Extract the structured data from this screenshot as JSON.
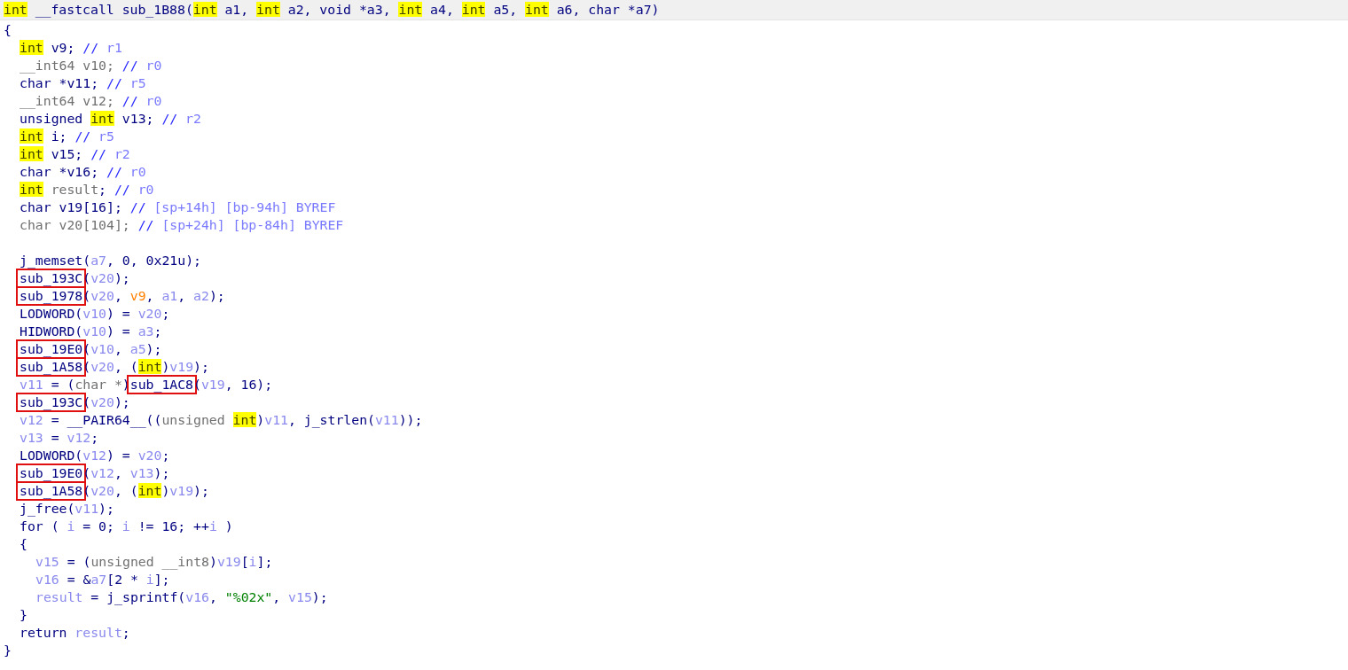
{
  "signature": [
    {
      "text": "int",
      "kind": "hl"
    },
    {
      "text": " __fastcall sub_1B88(",
      "kind": "p"
    },
    {
      "text": "int",
      "kind": "hl"
    },
    {
      "text": " a1, ",
      "kind": "p"
    },
    {
      "text": "int",
      "kind": "hl"
    },
    {
      "text": " a2, void *a3, ",
      "kind": "p"
    },
    {
      "text": "int",
      "kind": "hl"
    },
    {
      "text": " a4, ",
      "kind": "p"
    },
    {
      "text": "int",
      "kind": "hl"
    },
    {
      "text": " a5, ",
      "kind": "p"
    },
    {
      "text": "int",
      "kind": "hl"
    },
    {
      "text": " a6, char *a7)",
      "kind": "p"
    }
  ],
  "lines": [
    {
      "kind": "top",
      "tokens": [
        {
          "text": "{",
          "kind": "p"
        }
      ]
    },
    {
      "kind": "body",
      "tokens": [
        {
          "text": "int",
          "kind": "hl"
        },
        {
          "text": " v9; ",
          "kind": "p"
        },
        {
          "text": "// ",
          "kind": "c"
        },
        {
          "text": "r1",
          "kind": "cm"
        }
      ]
    },
    {
      "kind": "body",
      "tokens": [
        {
          "text": "__int64 v10; ",
          "kind": "g"
        },
        {
          "text": "// ",
          "kind": "c"
        },
        {
          "text": "r0",
          "kind": "cm"
        }
      ]
    },
    {
      "kind": "body",
      "tokens": [
        {
          "text": "char *v11; ",
          "kind": "p"
        },
        {
          "text": "// ",
          "kind": "c"
        },
        {
          "text": "r5",
          "kind": "cm"
        }
      ]
    },
    {
      "kind": "body",
      "tokens": [
        {
          "text": "__int64 v12; ",
          "kind": "g"
        },
        {
          "text": "// ",
          "kind": "c"
        },
        {
          "text": "r0",
          "kind": "cm"
        }
      ]
    },
    {
      "kind": "body",
      "tokens": [
        {
          "text": "unsigned ",
          "kind": "p"
        },
        {
          "text": "int",
          "kind": "hl"
        },
        {
          "text": " v13; ",
          "kind": "p"
        },
        {
          "text": "// ",
          "kind": "c"
        },
        {
          "text": "r2",
          "kind": "cm"
        }
      ]
    },
    {
      "kind": "body",
      "tokens": [
        {
          "text": "int",
          "kind": "hl"
        },
        {
          "text": " i; ",
          "kind": "p"
        },
        {
          "text": "// ",
          "kind": "c"
        },
        {
          "text": "r5",
          "kind": "cm"
        }
      ]
    },
    {
      "kind": "body",
      "tokens": [
        {
          "text": "int",
          "kind": "hl"
        },
        {
          "text": " v15; ",
          "kind": "p"
        },
        {
          "text": "// ",
          "kind": "c"
        },
        {
          "text": "r2",
          "kind": "cm"
        }
      ]
    },
    {
      "kind": "body",
      "tokens": [
        {
          "text": "char *v16; ",
          "kind": "p"
        },
        {
          "text": "// ",
          "kind": "c"
        },
        {
          "text": "r0",
          "kind": "cm"
        }
      ]
    },
    {
      "kind": "body",
      "tokens": [
        {
          "text": "int",
          "kind": "hl"
        },
        {
          "text": " result",
          "kind": "g"
        },
        {
          "text": "; ",
          "kind": "p"
        },
        {
          "text": "// ",
          "kind": "c"
        },
        {
          "text": "r0",
          "kind": "cm"
        }
      ]
    },
    {
      "kind": "body",
      "tokens": [
        {
          "text": "char v19[16]; ",
          "kind": "p"
        },
        {
          "text": "// ",
          "kind": "c"
        },
        {
          "text": "[sp+14h] [bp-94h] BYREF",
          "kind": "cm"
        }
      ]
    },
    {
      "kind": "body",
      "tokens": [
        {
          "text": "char v20[104]; ",
          "kind": "g"
        },
        {
          "text": "// ",
          "kind": "c"
        },
        {
          "text": "[sp+24h] [bp-84h] BYREF",
          "kind": "cm"
        }
      ]
    },
    {
      "kind": "blank"
    },
    {
      "kind": "body",
      "tokens": [
        {
          "text": "j_memset(",
          "kind": "p"
        },
        {
          "text": "a7",
          "kind": "v"
        },
        {
          "text": ", ",
          "kind": "p"
        },
        {
          "text": "0",
          "kind": "n"
        },
        {
          "text": ", ",
          "kind": "p"
        },
        {
          "text": "0x21u",
          "kind": "n"
        },
        {
          "text": ");",
          "kind": "p"
        }
      ]
    },
    {
      "kind": "body",
      "tokens": [
        {
          "text": "sub_193C",
          "kind": "box"
        },
        {
          "text": "(",
          "kind": "p"
        },
        {
          "text": "v20",
          "kind": "v"
        },
        {
          "text": ");",
          "kind": "p"
        }
      ]
    },
    {
      "kind": "body",
      "tokens": [
        {
          "text": "sub_1978",
          "kind": "box"
        },
        {
          "text": "(",
          "kind": "p"
        },
        {
          "text": "v20",
          "kind": "v"
        },
        {
          "text": ", ",
          "kind": "p"
        },
        {
          "text": "v9",
          "kind": "rv"
        },
        {
          "text": ", ",
          "kind": "p"
        },
        {
          "text": "a1",
          "kind": "v"
        },
        {
          "text": ", ",
          "kind": "p"
        },
        {
          "text": "a2",
          "kind": "v"
        },
        {
          "text": ");",
          "kind": "p"
        }
      ]
    },
    {
      "kind": "body",
      "tokens": [
        {
          "text": "LODWORD(",
          "kind": "p"
        },
        {
          "text": "v10",
          "kind": "v"
        },
        {
          "text": ") = ",
          "kind": "p"
        },
        {
          "text": "v20",
          "kind": "v"
        },
        {
          "text": ";",
          "kind": "p"
        }
      ]
    },
    {
      "kind": "body",
      "tokens": [
        {
          "text": "HIDWORD(",
          "kind": "p"
        },
        {
          "text": "v10",
          "kind": "v"
        },
        {
          "text": ") = ",
          "kind": "p"
        },
        {
          "text": "a3",
          "kind": "v"
        },
        {
          "text": ";",
          "kind": "p"
        }
      ]
    },
    {
      "kind": "body",
      "tokens": [
        {
          "text": "sub_19E0",
          "kind": "box"
        },
        {
          "text": "(",
          "kind": "p"
        },
        {
          "text": "v10",
          "kind": "v"
        },
        {
          "text": ", ",
          "kind": "p"
        },
        {
          "text": "a5",
          "kind": "v"
        },
        {
          "text": ");",
          "kind": "p"
        }
      ]
    },
    {
      "kind": "body",
      "tokens": [
        {
          "text": "sub_1A58",
          "kind": "box"
        },
        {
          "text": "(",
          "kind": "p"
        },
        {
          "text": "v20",
          "kind": "v"
        },
        {
          "text": ", (",
          "kind": "p"
        },
        {
          "text": "int",
          "kind": "hl"
        },
        {
          "text": ")",
          "kind": "p"
        },
        {
          "text": "v19",
          "kind": "v"
        },
        {
          "text": ");",
          "kind": "p"
        }
      ]
    },
    {
      "kind": "body",
      "tokens": [
        {
          "text": "v11",
          "kind": "v"
        },
        {
          "text": " = (",
          "kind": "p"
        },
        {
          "text": "char *",
          "kind": "g"
        },
        {
          "text": ")",
          "kind": "p"
        },
        {
          "text": "sub_1AC8",
          "kind": "box"
        },
        {
          "text": "(",
          "kind": "p"
        },
        {
          "text": "v19",
          "kind": "v"
        },
        {
          "text": ", ",
          "kind": "p"
        },
        {
          "text": "16",
          "kind": "n"
        },
        {
          "text": ");",
          "kind": "p"
        }
      ]
    },
    {
      "kind": "body",
      "tokens": [
        {
          "text": "sub_193C",
          "kind": "box"
        },
        {
          "text": "(",
          "kind": "p"
        },
        {
          "text": "v20",
          "kind": "v"
        },
        {
          "text": ");",
          "kind": "p"
        }
      ]
    },
    {
      "kind": "body",
      "tokens": [
        {
          "text": "v12",
          "kind": "v"
        },
        {
          "text": " = __PAIR64__((",
          "kind": "p"
        },
        {
          "text": "unsigned ",
          "kind": "g"
        },
        {
          "text": "int",
          "kind": "hl"
        },
        {
          "text": ")",
          "kind": "p"
        },
        {
          "text": "v11",
          "kind": "v"
        },
        {
          "text": ", j_strlen(",
          "kind": "p"
        },
        {
          "text": "v11",
          "kind": "v"
        },
        {
          "text": "));",
          "kind": "p"
        }
      ]
    },
    {
      "kind": "body",
      "tokens": [
        {
          "text": "v13",
          "kind": "v"
        },
        {
          "text": " = ",
          "kind": "p"
        },
        {
          "text": "v12",
          "kind": "v"
        },
        {
          "text": ";",
          "kind": "p"
        }
      ]
    },
    {
      "kind": "body",
      "tokens": [
        {
          "text": "LODWORD(",
          "kind": "p"
        },
        {
          "text": "v12",
          "kind": "v"
        },
        {
          "text": ") = ",
          "kind": "p"
        },
        {
          "text": "v20",
          "kind": "v"
        },
        {
          "text": ";",
          "kind": "p"
        }
      ]
    },
    {
      "kind": "body",
      "tokens": [
        {
          "text": "sub_19E0",
          "kind": "box"
        },
        {
          "text": "(",
          "kind": "p"
        },
        {
          "text": "v12",
          "kind": "v"
        },
        {
          "text": ", ",
          "kind": "p"
        },
        {
          "text": "v13",
          "kind": "v"
        },
        {
          "text": ");",
          "kind": "p"
        }
      ]
    },
    {
      "kind": "body",
      "tokens": [
        {
          "text": "sub_1A58",
          "kind": "box"
        },
        {
          "text": "(",
          "kind": "p"
        },
        {
          "text": "v20",
          "kind": "v"
        },
        {
          "text": ", (",
          "kind": "p"
        },
        {
          "text": "int",
          "kind": "hl"
        },
        {
          "text": ")",
          "kind": "p"
        },
        {
          "text": "v19",
          "kind": "v"
        },
        {
          "text": ");",
          "kind": "p"
        }
      ]
    },
    {
      "kind": "body",
      "tokens": [
        {
          "text": "j_free(",
          "kind": "p"
        },
        {
          "text": "v11",
          "kind": "v"
        },
        {
          "text": ");",
          "kind": "p"
        }
      ]
    },
    {
      "kind": "body",
      "tokens": [
        {
          "text": "for ( ",
          "kind": "p"
        },
        {
          "text": "i",
          "kind": "v"
        },
        {
          "text": " = ",
          "kind": "p"
        },
        {
          "text": "0",
          "kind": "n"
        },
        {
          "text": "; ",
          "kind": "p"
        },
        {
          "text": "i",
          "kind": "v"
        },
        {
          "text": " != ",
          "kind": "p"
        },
        {
          "text": "16",
          "kind": "n"
        },
        {
          "text": "; ++",
          "kind": "p"
        },
        {
          "text": "i",
          "kind": "v"
        },
        {
          "text": " )",
          "kind": "p"
        }
      ]
    },
    {
      "kind": "body",
      "tokens": [
        {
          "text": "{",
          "kind": "p"
        }
      ]
    },
    {
      "kind": "inner",
      "tokens": [
        {
          "text": "v15",
          "kind": "v"
        },
        {
          "text": " = (",
          "kind": "p"
        },
        {
          "text": "unsigned __int8",
          "kind": "g"
        },
        {
          "text": ")",
          "kind": "p"
        },
        {
          "text": "v19",
          "kind": "v"
        },
        {
          "text": "[",
          "kind": "p"
        },
        {
          "text": "i",
          "kind": "v"
        },
        {
          "text": "];",
          "kind": "p"
        }
      ]
    },
    {
      "kind": "inner",
      "tokens": [
        {
          "text": "v16",
          "kind": "v"
        },
        {
          "text": " = &",
          "kind": "p"
        },
        {
          "text": "a7",
          "kind": "v"
        },
        {
          "text": "[",
          "kind": "p"
        },
        {
          "text": "2",
          "kind": "n"
        },
        {
          "text": " * ",
          "kind": "p"
        },
        {
          "text": "i",
          "kind": "v"
        },
        {
          "text": "];",
          "kind": "p"
        }
      ]
    },
    {
      "kind": "inner",
      "tokens": [
        {
          "text": "result",
          "kind": "v"
        },
        {
          "text": " = j_sprintf(",
          "kind": "p"
        },
        {
          "text": "v16",
          "kind": "v"
        },
        {
          "text": ", ",
          "kind": "p"
        },
        {
          "text": "\"%02x\"",
          "kind": "s"
        },
        {
          "text": ", ",
          "kind": "p"
        },
        {
          "text": "v15",
          "kind": "v"
        },
        {
          "text": ");",
          "kind": "p"
        }
      ]
    },
    {
      "kind": "body",
      "tokens": [
        {
          "text": "}",
          "kind": "p"
        }
      ]
    },
    {
      "kind": "body",
      "tokens": [
        {
          "text": "return ",
          "kind": "p"
        },
        {
          "text": "result",
          "kind": "v"
        },
        {
          "text": ";",
          "kind": "p"
        }
      ]
    },
    {
      "kind": "top",
      "tokens": [
        {
          "text": "}",
          "kind": "p"
        }
      ]
    }
  ]
}
